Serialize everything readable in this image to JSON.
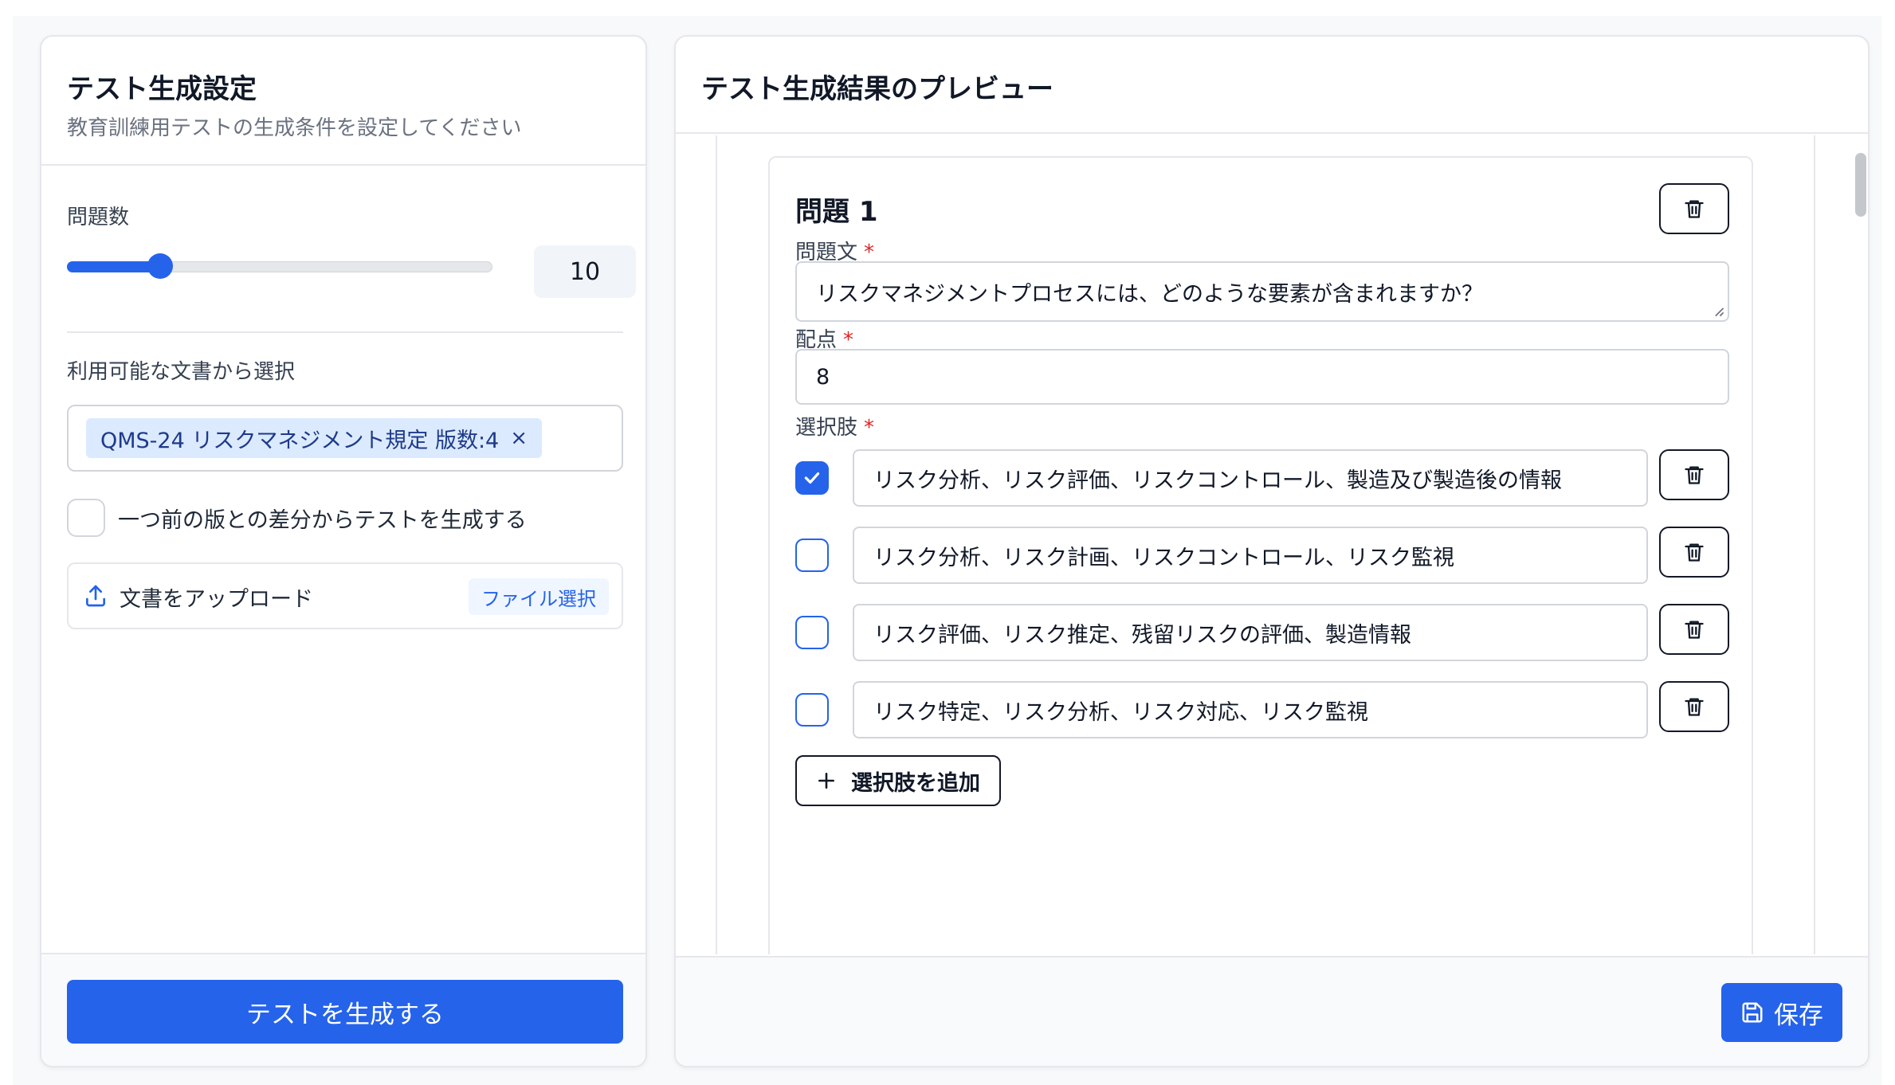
{
  "settings": {
    "title": "テスト生成設定",
    "subtitle": "教育訓練用テストの生成条件を設定してください",
    "question_count_label": "問題数",
    "question_count": "10",
    "slider_fraction": 0.22,
    "documents_label": "利用可能な文書から選択",
    "selected_document": "QMS-24 リスクマネジメント規定 版数:4",
    "remove_symbol": "×",
    "diff_checkbox_label": "一つ前の版との差分からテストを生成する",
    "diff_checked": false,
    "upload_label": "文書をアップロード",
    "file_select_label": "ファイル選択",
    "generate_button": "テストを生成する"
  },
  "preview": {
    "title": "テスト生成結果のプレビュー",
    "question_title": "問題 1",
    "question_text_label": "問題文",
    "question_text": "リスクマネジメントプロセスには、どのような要素が含まれますか？",
    "points_label": "配点",
    "points": "8",
    "choices_label": "選択肢",
    "required_mark": "*",
    "choices": [
      {
        "text": "リスク分析、リスク評価、リスクコントロール、製造及び製造後の情報",
        "checked": true
      },
      {
        "text": "リスク分析、リスク計画、リスクコントロール、リスク監視",
        "checked": false
      },
      {
        "text": "リスク評価、リスク推定、残留リスクの評価、製造情報",
        "checked": false
      },
      {
        "text": "リスク特定、リスク分析、リスク対応、リスク監視",
        "checked": false
      }
    ],
    "add_choice_button": "選択肢を追加",
    "save_button": "保存"
  },
  "icons": {
    "delete": "trash-icon",
    "upload": "upload-icon",
    "add": "plus-icon",
    "save": "save-icon",
    "check": "check-icon"
  },
  "colors": {
    "accent": "#2563eb",
    "required": "#dc2626",
    "chip_bg": "#dbeafe"
  }
}
